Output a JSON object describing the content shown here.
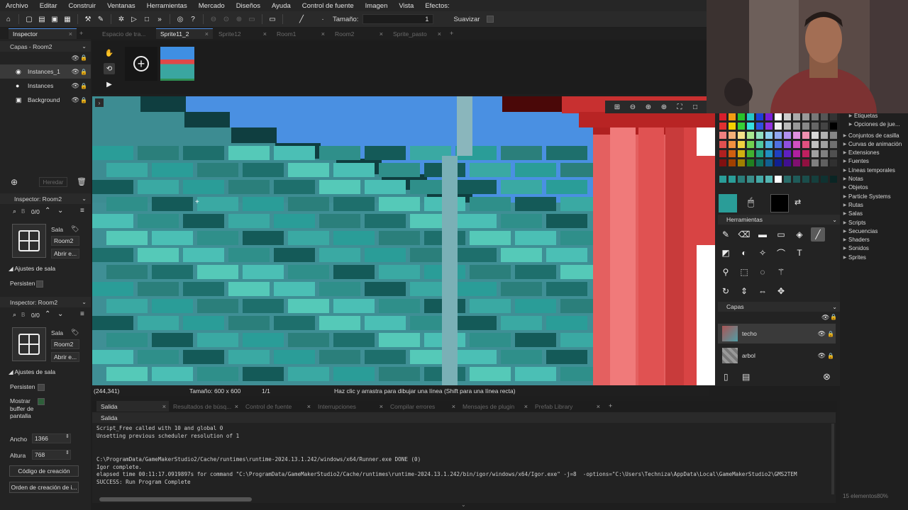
{
  "menu": [
    "Archivo",
    "Editar",
    "Construir",
    "Ventanas",
    "Herramientas",
    "Mercado",
    "Diseños",
    "Ayuda",
    "Control de fuente",
    "Imagen",
    "Vista",
    "Efectos:"
  ],
  "toolbar": {
    "size_label": "Tamaño:",
    "size_value": "1",
    "smooth_label": "Suavizar"
  },
  "tabs": [
    {
      "label": "Inspector",
      "active": true
    },
    {
      "label": "Espacio de tra...",
      "active": false
    },
    {
      "label": "Sprite11_2",
      "active": true
    },
    {
      "label": "Sprite12",
      "active": false
    },
    {
      "label": "Room1",
      "active": false
    },
    {
      "label": "Room2",
      "active": false
    },
    {
      "label": "Sprite_pasto",
      "active": false
    }
  ],
  "left": {
    "layers_dropdown": "Capas - Room2",
    "layers": [
      {
        "label": "Instances_1",
        "icon": "radio-icon",
        "selected": true
      },
      {
        "label": "Instances",
        "icon": "dot-icon",
        "selected": false
      },
      {
        "label": "Background",
        "icon": "image-icon",
        "selected": false
      }
    ],
    "inherit_label": "Heredar",
    "inspector1": {
      "title": "Inspector: Room2",
      "search": "B",
      "count": "0/0",
      "type": "Sala",
      "name": "Room2",
      "open": "Abrir e...",
      "section": "Ajustes de sala",
      "persistent": "Persisten"
    },
    "inspector2": {
      "title": "Inspector: Room2",
      "search": "B",
      "count": "0/0",
      "type": "Sala",
      "name": "Room2",
      "open": "Abrir e...",
      "section": "Ajustes de sala",
      "persistent": "Persisten",
      "show_buffer": "Mostrar buffer de pantalla",
      "width_label": "Ancho",
      "width_value": "1366",
      "height_label": "Altura",
      "height_value": "768",
      "creation_code": "Código de creación",
      "creation_order": "Orden de creación de i..."
    }
  },
  "status": {
    "coords": "(244,341)",
    "size": "Tamaño: 600 x 600",
    "frame": "1/1",
    "hint": "Haz clic y arrastra para dibujar una línea (Shift para una línea recta)"
  },
  "output_tabs": [
    "Salida",
    "Resultados de búsq...",
    "Control de fuente",
    "Interrupciones",
    "Compilar errores",
    "Mensajes de plugin",
    "Prefab Library"
  ],
  "output": {
    "subhead": "Salida",
    "lines": [
      "Script_Free called with 10 and global 0",
      "Unsetting previous scheduler resolution of 1",
      "",
      "",
      "C:\\ProgramData/GameMakerStudio2/Cache/runtimes\\runtime-2024.13.1.242/windows/x64/Runner.exe DONE (0)",
      "Igor complete.",
      "elapsed time 00:11:17.0919897s for command \"C:\\ProgramData/GameMakerStudio2/Cache/runtimes\\runtime-2024.13.1.242/bin/igor/windows/x64/Igor.exe\" -j=8  -options=\"C:\\Users\\Techniza\\AppData\\Local\\GameMakerStudio2\\GMS2TEM",
      "SUCCESS: Run Program Complete"
    ]
  },
  "right": {
    "tools_header": "Herramientas",
    "layers_header": "Capas",
    "layers": [
      {
        "label": "techo",
        "selected": true
      },
      {
        "label": "arbol",
        "selected": false
      }
    ],
    "primary_color": "#2a9d98",
    "secondary_color": "#000000"
  },
  "assets": [
    "Etiquetas",
    "Opciones de jue...",
    "Conjuntos de casilla",
    "Curvas de animación",
    "Extensiones",
    "Fuentes",
    "Líneas temporales",
    "Notas",
    "Objetos",
    "Particle Systems",
    "Rutas",
    "Salas",
    "Scripts",
    "Secuencias",
    "Shaders",
    "Sonidos",
    "Sprites"
  ],
  "assets_footer": "15 elementos80%"
}
